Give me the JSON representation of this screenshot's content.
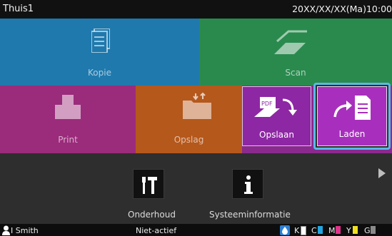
{
  "header": {
    "title": "Thuis1",
    "datetime": "20XX/XX/XX(Ma)10:00"
  },
  "tiles": {
    "kopie": {
      "label": "Kopie",
      "color": "#1f79ad"
    },
    "scan": {
      "label": "Scan",
      "color": "#2a8a4e"
    },
    "print": {
      "label": "Print",
      "color": "#9b2b7b"
    },
    "opslag": {
      "label": "Opslag",
      "color": "#b5581c"
    }
  },
  "opslag_popup": {
    "opslaan": {
      "label": "Opslaan"
    },
    "laden": {
      "label": "Laden"
    }
  },
  "tools": {
    "onderhoud": {
      "label": "Onderhoud"
    },
    "systeeminformatie": {
      "label": "Systeeminformatie"
    }
  },
  "status": {
    "user": "I Smith",
    "state": "Niet-actief",
    "ink": [
      {
        "name": "K",
        "color": "#222222"
      },
      {
        "name": "C",
        "color": "#23a6e0"
      },
      {
        "name": "M",
        "color": "#e0338a"
      },
      {
        "name": "Y",
        "color": "#f0e020"
      },
      {
        "name": "G",
        "color": "#8a8a8a"
      }
    ]
  },
  "accent": "#5bb8e6"
}
